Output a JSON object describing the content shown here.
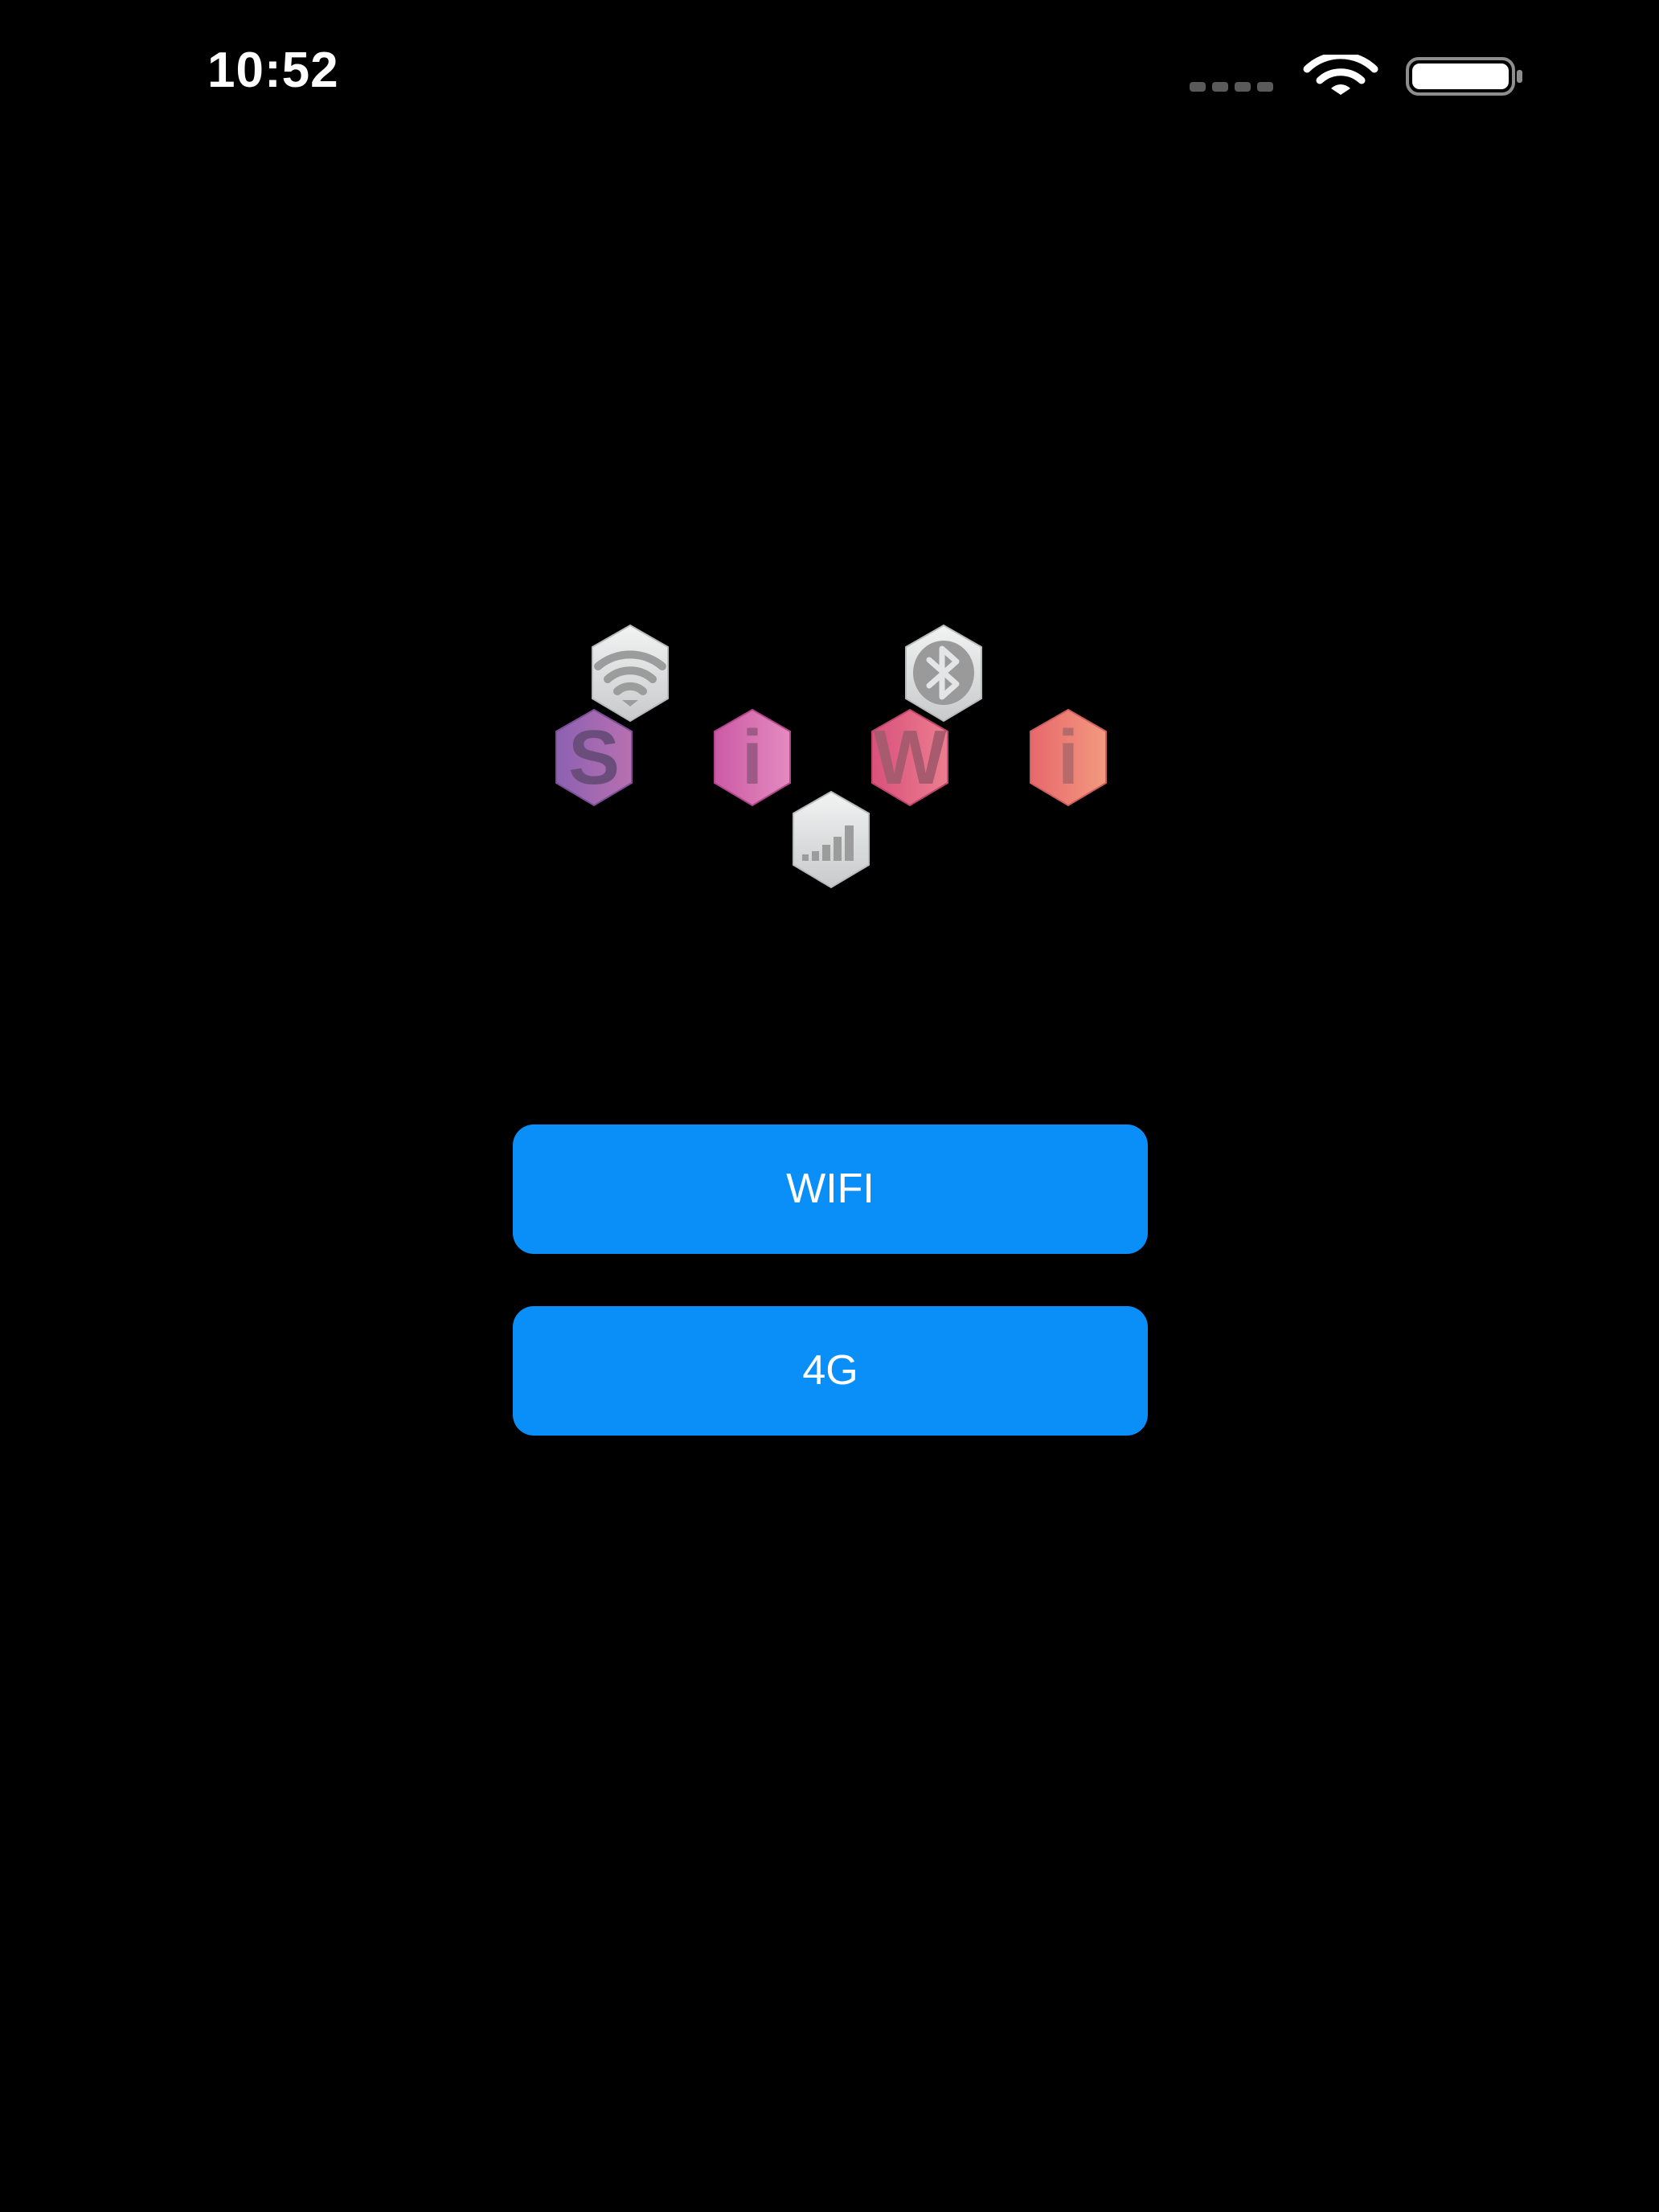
{
  "status_bar": {
    "time": "10:52",
    "icons": [
      "cellular-signal-icon",
      "wifi-icon",
      "battery-icon"
    ]
  },
  "logo": {
    "letters": [
      "S",
      "i",
      "W",
      "i"
    ],
    "icons": [
      "wifi-icon",
      "bluetooth-icon",
      "cellular-signal-icon"
    ],
    "colors": {
      "purple": "#9a5fb2",
      "magenta": "#d8579f",
      "pink": "#e15c7d",
      "salmon": "#ec7c70",
      "gray": "#d9dbdc"
    }
  },
  "buttons": {
    "wifi_label": "WIFI",
    "g4_label": "4G"
  },
  "colors": {
    "background": "#000000",
    "button": "#0a8ff9",
    "button_text": "#ffffff"
  }
}
